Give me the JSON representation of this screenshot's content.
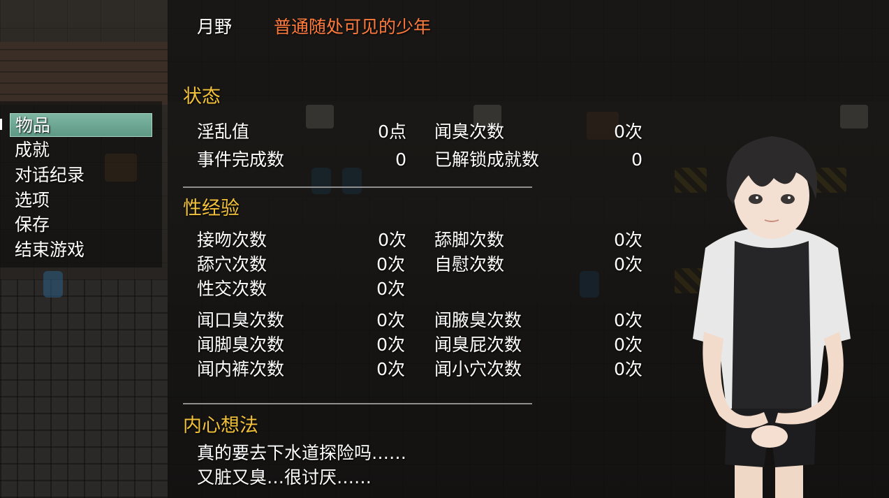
{
  "header": {
    "name": "月野",
    "title": "普通随处可见的少年",
    "title_color": "#ff7a3d"
  },
  "menu": {
    "items": [
      "物品",
      "成就",
      "对话纪录",
      "选项",
      "保存",
      "结束游戏"
    ],
    "selected_index": 0
  },
  "status": {
    "heading": "状态",
    "rows": [
      {
        "l_label": "淫乱值",
        "l_value": "0点",
        "r_label": "闻臭次数",
        "r_value": "0次"
      },
      {
        "l_label": "事件完成数",
        "l_value": "0",
        "r_label": "已解锁成就数",
        "r_value": "0"
      }
    ]
  },
  "experience": {
    "heading": "性经验",
    "rows": [
      {
        "l_label": "接吻次数",
        "l_value": "0次",
        "r_label": "舔脚次数",
        "r_value": "0次"
      },
      {
        "l_label": "舔穴次数",
        "l_value": "0次",
        "r_label": "自慰次数",
        "r_value": "0次"
      },
      {
        "l_label": "性交次数",
        "l_value": "0次",
        "r_label": "",
        "r_value": ""
      }
    ],
    "rows2": [
      {
        "l_label": "闻口臭次数",
        "l_value": "0次",
        "r_label": "闻腋臭次数",
        "r_value": "0次"
      },
      {
        "l_label": "闻脚臭次数",
        "l_value": "0次",
        "r_label": "闻臭屁次数",
        "r_value": "0次"
      },
      {
        "l_label": "闻内裤次数",
        "l_value": "0次",
        "r_label": "闻小穴次数",
        "r_value": "0次"
      }
    ]
  },
  "thoughts": {
    "heading": "内心想法",
    "lines": [
      "真的要去下水道探险吗……",
      "又脏又臭…很讨厌……"
    ]
  },
  "colors": {
    "heading": "#f2c13a",
    "menu_selected": "#7eb5a2",
    "text": "#ffffff"
  },
  "icons": [
    "menu-cursor-icon"
  ]
}
